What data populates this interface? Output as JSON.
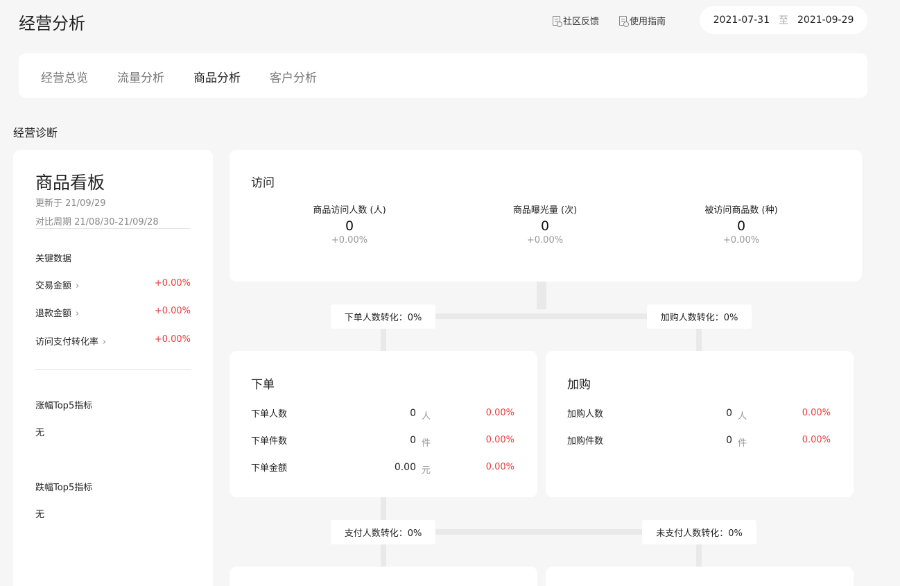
{
  "header": {
    "title": "经营分析",
    "links": [
      "社区反馈",
      "使用指南"
    ],
    "date_start": "2021-07-31",
    "date_sep": "至",
    "date_end": "2021-09-29"
  },
  "tabs": [
    "经营总览",
    "流量分析",
    "商品分析",
    "客户分析"
  ],
  "active_tab": "商品分析",
  "section_title": "经营诊断",
  "board": {
    "title": "商品看板",
    "updated": "更新于 21/09/29",
    "compare": "对比周期 21/08/30-21/09/28",
    "key_label": "关键数据",
    "metrics": [
      {
        "label": "交易金额",
        "value": "+0.00%"
      },
      {
        "label": "退款金额",
        "value": "+0.00%"
      },
      {
        "label": "访问支付转化率",
        "value": "+0.00%"
      }
    ],
    "top_up_title": "涨幅Top5指标",
    "top_up_value": "无",
    "top_down_title": "跌幅Top5指标",
    "top_down_value": "无"
  },
  "visit": {
    "title": "访问",
    "stats": [
      {
        "label": "商品访问人数 (人)",
        "value": "0",
        "change": "+0.00%"
      },
      {
        "label": "商品曝光量 (次)",
        "value": "0",
        "change": "+0.00%"
      },
      {
        "label": "被访问商品数 (种)",
        "value": "0",
        "change": "+0.00%"
      }
    ]
  },
  "conversions": {
    "order": "下单人数转化：0%",
    "cart": "加购人数转化：0%",
    "pay": "支付人数转化：0%",
    "unpaid": "未支付人数转化：0%"
  },
  "order": {
    "title": "下单",
    "rows": [
      {
        "label": "下单人数",
        "value": "0",
        "unit": "人",
        "change": "0.00%"
      },
      {
        "label": "下单件数",
        "value": "0",
        "unit": "件",
        "change": "0.00%"
      },
      {
        "label": "下单金额",
        "value": "0.00",
        "unit": "元",
        "change": "0.00%"
      }
    ]
  },
  "cart": {
    "title": "加购",
    "rows": [
      {
        "label": "加购人数",
        "value": "0",
        "unit": "人",
        "change": "0.00%"
      },
      {
        "label": "加购件数",
        "value": "0",
        "unit": "件",
        "change": "0.00%"
      }
    ]
  },
  "icons": {
    "link_icon": "document-feedback-icon",
    "chevron": "chevron-right-icon"
  },
  "colors": {
    "negative": "#e83b3b",
    "background": "#f6f6f6",
    "card": "#ffffff"
  }
}
